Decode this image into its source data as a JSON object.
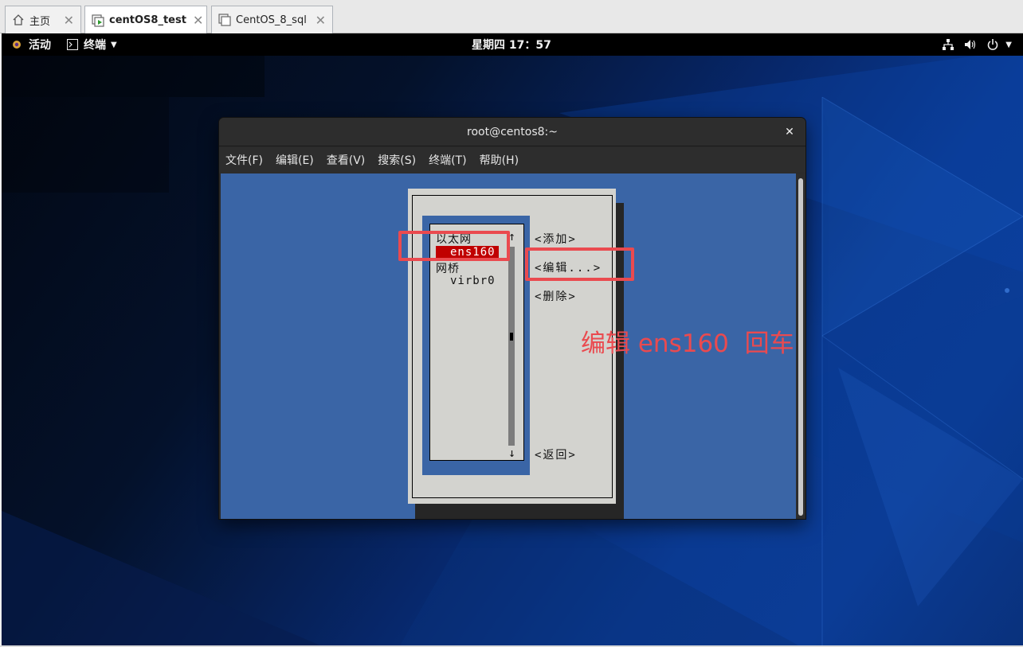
{
  "vm_tabs": [
    {
      "label": "主页",
      "icon": "home-icon",
      "active": false
    },
    {
      "label": "centOS8_test",
      "icon": "vm-running-icon",
      "active": true
    },
    {
      "label": "CentOS_8_sql",
      "icon": "vm-icon",
      "active": false
    }
  ],
  "topbar": {
    "activities": "活动",
    "terminal_menu": "终端",
    "clock": "星期四 17：57",
    "tray_icons": [
      "network-icon",
      "volume-icon",
      "power-icon"
    ]
  },
  "terminal": {
    "title": "root@centos8:~",
    "menu": [
      "文件(F)",
      "编辑(E)",
      "查看(V)",
      "搜索(S)",
      "终端(T)",
      "帮助(H)"
    ]
  },
  "nmtui": {
    "groups": [
      {
        "label": "以太网",
        "items": [
          "ens160"
        ]
      },
      {
        "label": "网桥",
        "items": [
          "virbr0"
        ]
      }
    ],
    "selected": "ens160",
    "buttons": {
      "add": "<添加>",
      "edit": "<编辑...>",
      "delete": "<删除>",
      "back": "<返回>"
    },
    "scroll_up": "↑",
    "scroll_down": "↓"
  },
  "annotation": {
    "text": "编辑 ens160  回车",
    "color": "#ea4a4f"
  },
  "colors": {
    "terminal_bg": "#3a65a6",
    "dialog_bg": "#d3d3cf",
    "selection": "#c00000"
  }
}
